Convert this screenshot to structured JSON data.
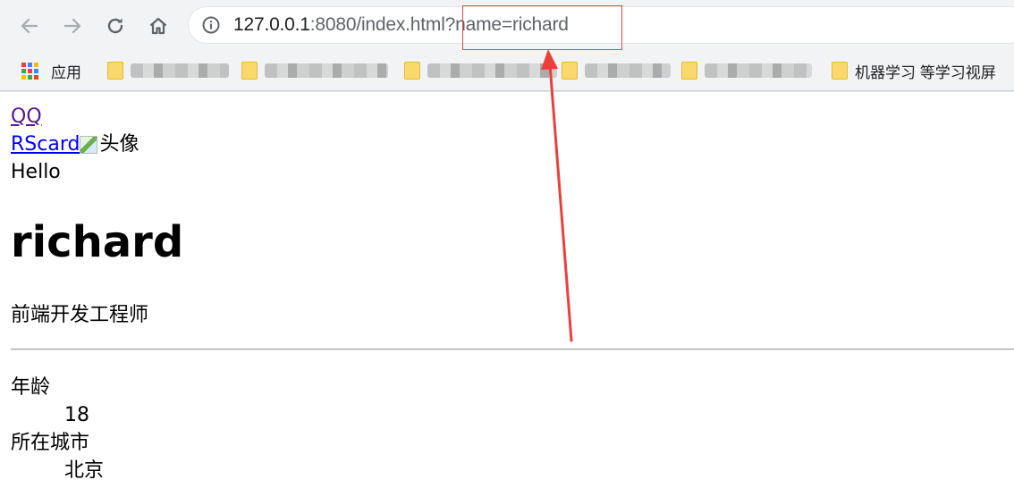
{
  "browser": {
    "url_host": "127.0.0.1",
    "url_rest": ":8080/index.html?name=richard",
    "bookmarks": {
      "apps_label": "应用",
      "last_folder_label": "机器学习 等学习视屏"
    },
    "icons": {
      "back": "arrow-left-icon",
      "forward": "arrow-right-icon",
      "reload": "reload-icon",
      "home": "home-icon",
      "info": "info-icon",
      "apps": "apps-grid-icon",
      "folder": "folder-icon"
    },
    "annotation_color": "#e8413b"
  },
  "page": {
    "links": {
      "qq": "QQ",
      "rscard": "RScard"
    },
    "avatar_alt": "头像",
    "greeting": "Hello",
    "name": "richard",
    "title": "前端开发工程师",
    "details": [
      {
        "term": "年龄",
        "value": "18"
      },
      {
        "term": "所在城市",
        "value": "北京"
      }
    ]
  }
}
